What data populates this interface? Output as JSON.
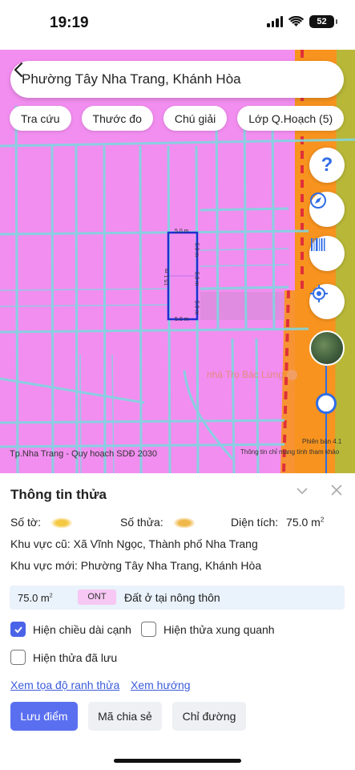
{
  "status_bar": {
    "time": "19:19",
    "battery": "52"
  },
  "search": {
    "text": "Phường Tây Nha Trang, Khánh Hòa"
  },
  "chips": [
    "Tra cứu",
    "Thước đo",
    "Chú giải",
    "Lớp Q.Hoạch (5)"
  ],
  "map_controls": {
    "help": "?",
    "icons": [
      "compass-icon",
      "barcode-icon",
      "locate-icon"
    ]
  },
  "map": {
    "plot_dims": {
      "top": "5.0 m",
      "bottom": "5.0 m",
      "left": "15.1 m",
      "inner_1": "5.0 m",
      "inner_2": "5.0 m",
      "inner_3": "5.0 m"
    },
    "poi": "nhà Trọ Bác Lừng",
    "layer_label": "Tp.Nha Trang - Quy hoạch SDĐ 2030",
    "map_version": "Phiên bản 4.1",
    "disclaimer": "Thông tin chỉ mang tính tham khảo",
    "colors": {
      "land": "#f28ef0",
      "road": "#7fd6e0",
      "orange_zone": "#f7931e",
      "green": "#8fcf4a"
    }
  },
  "sheet": {
    "title": "Thông tin thửa",
    "so_to_label": "Số tờ:",
    "so_thua_label": "Số thửa:",
    "dien_tich_label": "Diện tích:",
    "dien_tich_value": "75.0 m",
    "khu_vuc_cu": "Khu vực cũ: Xã Vĩnh Ngọc, Thành phố Nha Trang",
    "khu_vuc_moi": "Khu vực mới: Phường Tây Nha Trang, Khánh Hòa",
    "area_value": "75.0 m",
    "area_badge": "ONT",
    "area_desc": "Đất ở tại nông thôn",
    "checks": [
      {
        "label": "Hiện chiều dài cạnh",
        "checked": true
      },
      {
        "label": "Hiện thửa xung quanh",
        "checked": false
      },
      {
        "label": "Hiện thửa đã lưu",
        "checked": false
      }
    ],
    "links": [
      "Xem tọa độ ranh thửa",
      "Xem hướng"
    ],
    "buttons": {
      "save": "Lưu điểm",
      "share": "Mã chia sẻ",
      "directions": "Chỉ đường"
    }
  }
}
